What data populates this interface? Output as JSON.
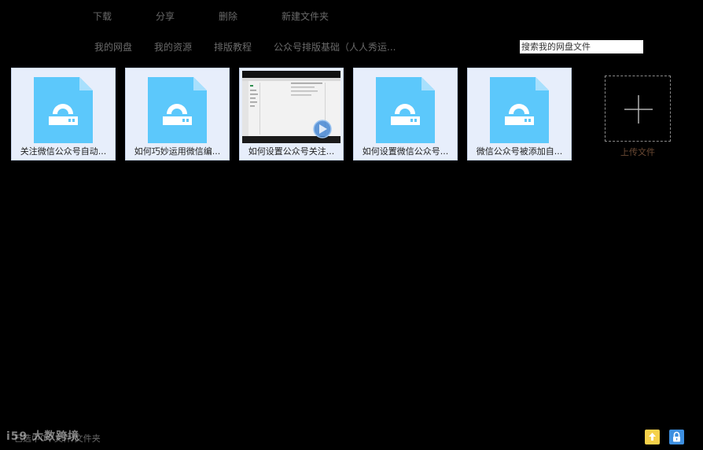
{
  "toolbar": {
    "download": "下载",
    "share": "分享",
    "delete": "删除",
    "new_folder": "新建文件夹"
  },
  "nav": {
    "my_disk": "我的网盘",
    "my_resources": "我的资源",
    "tutorial": "排版教程",
    "basics": "公众号排版基础（人人秀运..."
  },
  "search": {
    "placeholder": "搜索我的网盘文件"
  },
  "files": [
    {
      "name": "关注微信公众号自动...",
      "icon": "file-icon"
    },
    {
      "name": "如何巧妙运用微信编...",
      "icon": "file-icon"
    },
    {
      "name": "如何设置公众号关注...",
      "icon": "video-icon"
    },
    {
      "name": "如何设置微信公众号...",
      "icon": "file-icon"
    },
    {
      "name": "微信公众号被添加自...",
      "icon": "file-icon"
    }
  ],
  "upload": {
    "label": "上传文件"
  },
  "status": {
    "text": "已选中0个文件/文件夹"
  },
  "watermark": {
    "text": "i59 大数跨境"
  },
  "colors": {
    "background": "#000000",
    "tile": "#e7eefb",
    "file_icon": "#5cc8fb",
    "upload_label": "#6b4a34"
  }
}
